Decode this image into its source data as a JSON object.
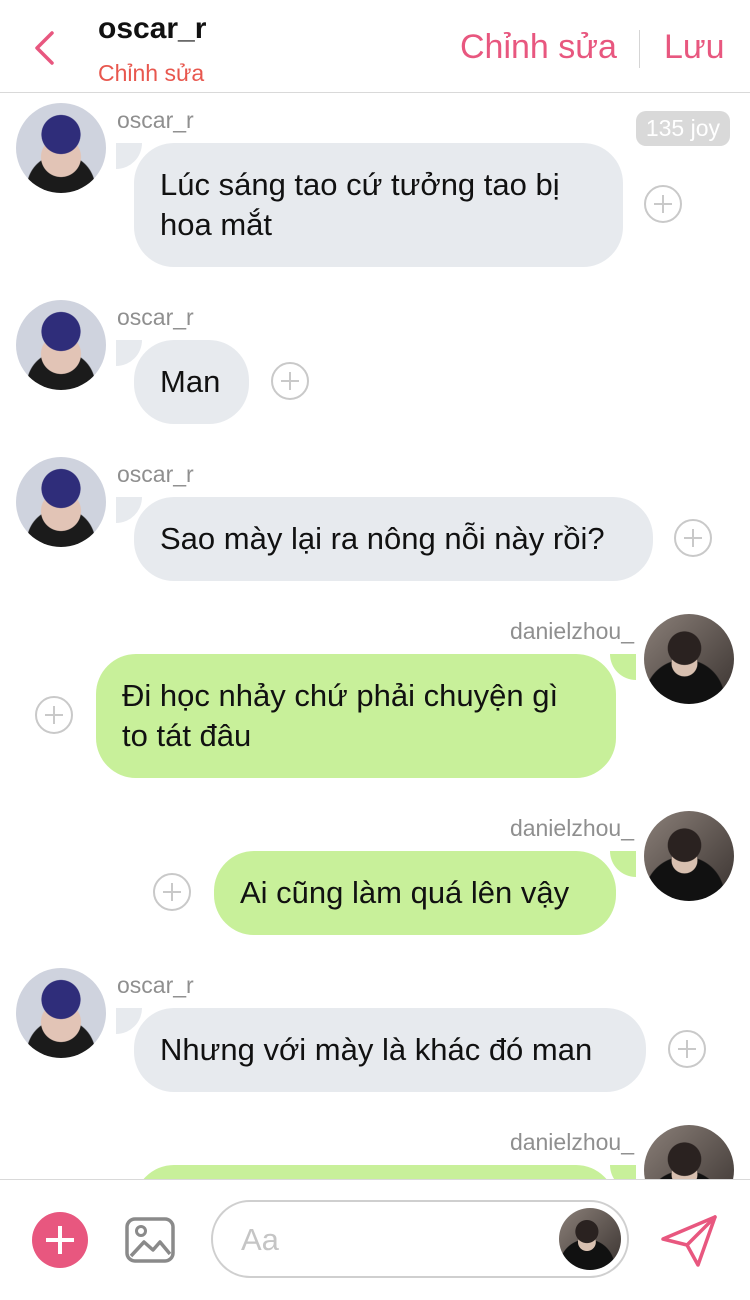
{
  "header": {
    "title": "oscar_r",
    "subtitle": "Chỉnh sửa",
    "edit_label": "Chỉnh sửa",
    "save_label": "Lưu",
    "accent": "#e8577f"
  },
  "joy_badge": "135 joy",
  "messages": [
    {
      "sender": "oscar_r",
      "side": "left",
      "text": "Lúc sáng tao cứ tưởng tao bị hoa mắt"
    },
    {
      "sender": "oscar_r",
      "side": "left",
      "text": "Man"
    },
    {
      "sender": "oscar_r",
      "side": "left",
      "text": "Sao mày lại ra nông nỗi này rồi?"
    },
    {
      "sender": "danielzhou_",
      "side": "right",
      "text": "Đi học nhảy chứ phải chuyện gì to tát đâu"
    },
    {
      "sender": "danielzhou_",
      "side": "right",
      "text": "Ai cũng làm quá lên vậy"
    },
    {
      "sender": "oscar_r",
      "side": "left",
      "text": "Nhưng với mày là khác đó man"
    },
    {
      "sender": "danielzhou_",
      "side": "right",
      "text": ""
    }
  ],
  "composer": {
    "placeholder": "Aa",
    "add_icon": "plus-icon",
    "image_icon": "image-icon",
    "send_icon": "send-icon"
  },
  "colors": {
    "left_bubble": "#e7eaee",
    "right_bubble": "#c8f09a",
    "subtitle": "#e8574e"
  }
}
